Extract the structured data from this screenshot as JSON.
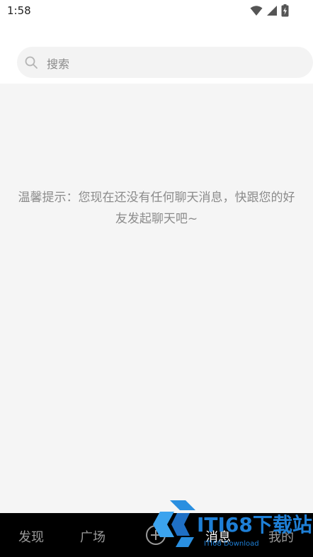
{
  "status_bar": {
    "time": "1:58"
  },
  "search": {
    "placeholder": "搜索"
  },
  "empty_state": {
    "tip": "温馨提示：您现在还没有任何聊天消息，快跟您的好友发起聊天吧~"
  },
  "tabbar": {
    "tabs": [
      {
        "label": "发现",
        "active": false
      },
      {
        "label": "广场",
        "active": false
      },
      {
        "label": "消息",
        "active": true
      },
      {
        "label": "我的",
        "active": false
      }
    ]
  },
  "watermark": {
    "brand": "ITI68下载站",
    "sub": "ITI68 Download"
  }
}
